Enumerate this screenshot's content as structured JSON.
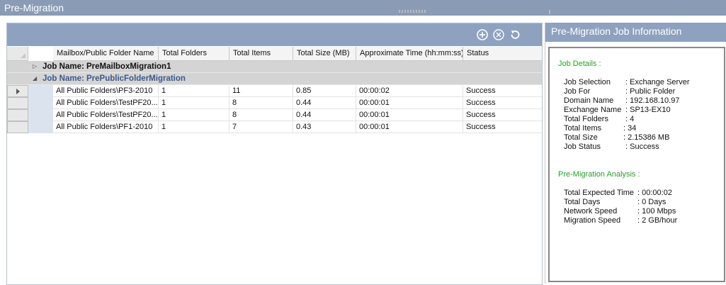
{
  "window": {
    "title": "Pre-Migration"
  },
  "toolbar": {
    "icons": [
      "add-circle-icon",
      "cancel-circle-icon",
      "refresh-icon"
    ]
  },
  "grid": {
    "columns": [
      "Mailbox/Public Folder Name",
      "Total Folders",
      "Total Items",
      "Total Size (MB)",
      "Approximate Time (hh:mm:ss)",
      "Status"
    ],
    "groups": [
      {
        "name": "Job Name: PreMailboxMigration1",
        "expanded": false,
        "toggle": "▷"
      },
      {
        "name": "Job Name: PrePublicFolderMigration",
        "expanded": true,
        "toggle": "◢"
      }
    ],
    "rows": [
      {
        "name": "All Public Folders\\PF3-2010",
        "folders": "1",
        "items": "11",
        "size": "0.85",
        "time": "00:00:02",
        "status": "Success"
      },
      {
        "name": "All Public Folders\\TestPF20...",
        "folders": "1",
        "items": "8",
        "size": "0.44",
        "time": "00:00:01",
        "status": "Success"
      },
      {
        "name": "All Public Folders\\TestPF20...",
        "folders": "1",
        "items": "8",
        "size": "0.44",
        "time": "00:00:01",
        "status": "Success"
      },
      {
        "name": "All Public Folders\\PF1-2010",
        "folders": "1",
        "items": "7",
        "size": "0.43",
        "time": "00:00:01",
        "status": "Success"
      }
    ]
  },
  "info": {
    "title": "Pre-Migration Job Information",
    "details_heading": "Job Details :",
    "details": [
      {
        "key": "Job Selection",
        "value": ": Exchange Server"
      },
      {
        "key": "Job For",
        "value": ": Public Folder"
      },
      {
        "key": "Domain Name",
        "value": ": 192.168.10.97"
      },
      {
        "key": "Exchange Name",
        "value": ": SP13-EX10"
      },
      {
        "key": "Total Folders",
        "value": ": 4"
      },
      {
        "key": "Total Items",
        "value": ": 34"
      },
      {
        "key": "Total Size",
        "value": ": 2.15386 MB"
      },
      {
        "key": "Job  Status",
        "value": ": Success"
      }
    ],
    "analysis_heading": "Pre-Migration Analysis :",
    "analysis": [
      {
        "key": "Total Expected Time",
        "value": ": 00:00:02"
      },
      {
        "key": "Total Days",
        "value": ": 0 Days"
      },
      {
        "key": "Network Speed",
        "value": ": 100 Mbps"
      },
      {
        "key": "Migration Speed",
        "value": ": 2 GB/hour"
      }
    ]
  }
}
